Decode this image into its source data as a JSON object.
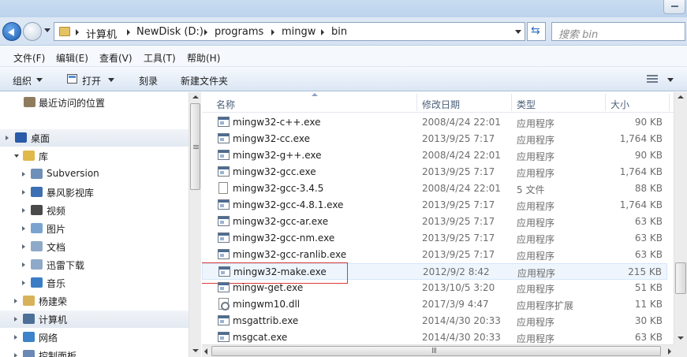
{
  "address": {
    "crumbs": [
      "计算机",
      "NewDisk (D:)",
      "programs",
      "mingw",
      "bin"
    ]
  },
  "search": {
    "placeholder": "搜索 bin"
  },
  "menu": [
    "文件(F)",
    "编辑(E)",
    "查看(V)",
    "工具(T)",
    "帮助(H)"
  ],
  "toolbar": {
    "organize": "组织",
    "open": "打开",
    "burn": "刻录",
    "new_folder": "新建文件夹"
  },
  "nav": {
    "items": [
      {
        "label": "最近访问的位置",
        "icon": "recent-places-icon",
        "color": "#8f7c5f"
      },
      {
        "label": "桌面",
        "icon": "desktop-icon",
        "color": "#2a5ba8"
      },
      {
        "label": "库",
        "icon": "libraries-icon",
        "color": "#e0b94a"
      },
      {
        "label": "Subversion",
        "icon": "subversion-library-icon",
        "color": "#6e8fb8"
      },
      {
        "label": "暴风影视库",
        "icon": "video-library-icon",
        "color": "#3d6fb3"
      },
      {
        "label": "视频",
        "icon": "videos-icon",
        "color": "#4a4a4a"
      },
      {
        "label": "图片",
        "icon": "pictures-icon",
        "color": "#7aa4cf"
      },
      {
        "label": "文档",
        "icon": "documents-icon",
        "color": "#8fa9c8"
      },
      {
        "label": "迅雷下载",
        "icon": "thunder-download-icon",
        "color": "#8fa9c8"
      },
      {
        "label": "音乐",
        "icon": "music-icon",
        "color": "#3a7dc4"
      },
      {
        "label": "杨建荣",
        "icon": "user-folder-icon",
        "color": "#d8b25a"
      },
      {
        "label": "计算机",
        "icon": "computer-icon",
        "color": "#4c6f98"
      },
      {
        "label": "网络",
        "icon": "network-icon",
        "color": "#3c83c9"
      },
      {
        "label": "控制面板",
        "icon": "control-panel-icon",
        "color": "#6a8ab5"
      }
    ]
  },
  "columns": {
    "name": "名称",
    "date": "修改日期",
    "type": "类型",
    "size": "大小"
  },
  "files": [
    {
      "name": "mingw32-c++.exe",
      "date": "2008/4/24 22:01",
      "type": "应用程序",
      "size": "90 KB",
      "icon": "exe"
    },
    {
      "name": "mingw32-cc.exe",
      "date": "2013/9/25 7:17",
      "type": "应用程序",
      "size": "1,764 KB",
      "icon": "exe"
    },
    {
      "name": "mingw32-g++.exe",
      "date": "2008/4/24 22:01",
      "type": "应用程序",
      "size": "90 KB",
      "icon": "exe"
    },
    {
      "name": "mingw32-gcc.exe",
      "date": "2013/9/25 7:17",
      "type": "应用程序",
      "size": "1,764 KB",
      "icon": "exe"
    },
    {
      "name": "mingw32-gcc-3.4.5",
      "date": "2008/4/24 22:01",
      "type": "5 文件",
      "size": "88 KB",
      "icon": "doc"
    },
    {
      "name": "mingw32-gcc-4.8.1.exe",
      "date": "2013/9/25 7:17",
      "type": "应用程序",
      "size": "1,764 KB",
      "icon": "exe"
    },
    {
      "name": "mingw32-gcc-ar.exe",
      "date": "2013/9/25 7:17",
      "type": "应用程序",
      "size": "63 KB",
      "icon": "exe"
    },
    {
      "name": "mingw32-gcc-nm.exe",
      "date": "2013/9/25 7:17",
      "type": "应用程序",
      "size": "63 KB",
      "icon": "exe"
    },
    {
      "name": "mingw32-gcc-ranlib.exe",
      "date": "2013/9/25 7:17",
      "type": "应用程序",
      "size": "63 KB",
      "icon": "exe"
    },
    {
      "name": "mingw32-make.exe",
      "date": "2012/9/2 8:42",
      "type": "应用程序",
      "size": "215 KB",
      "icon": "exe"
    },
    {
      "name": "mingw-get.exe",
      "date": "2013/10/5 3:20",
      "type": "应用程序",
      "size": "51 KB",
      "icon": "exe"
    },
    {
      "name": "mingwm10.dll",
      "date": "2017/3/9 4:47",
      "type": "应用程序扩展",
      "size": "11 KB",
      "icon": "dll"
    },
    {
      "name": "msgattrib.exe",
      "date": "2014/4/30 20:33",
      "type": "应用程序",
      "size": "30 KB",
      "icon": "exe"
    },
    {
      "name": "msgcat.exe",
      "date": "2014/4/30 20:33",
      "type": "应用程序",
      "size": "63 KB",
      "icon": "exe"
    }
  ]
}
